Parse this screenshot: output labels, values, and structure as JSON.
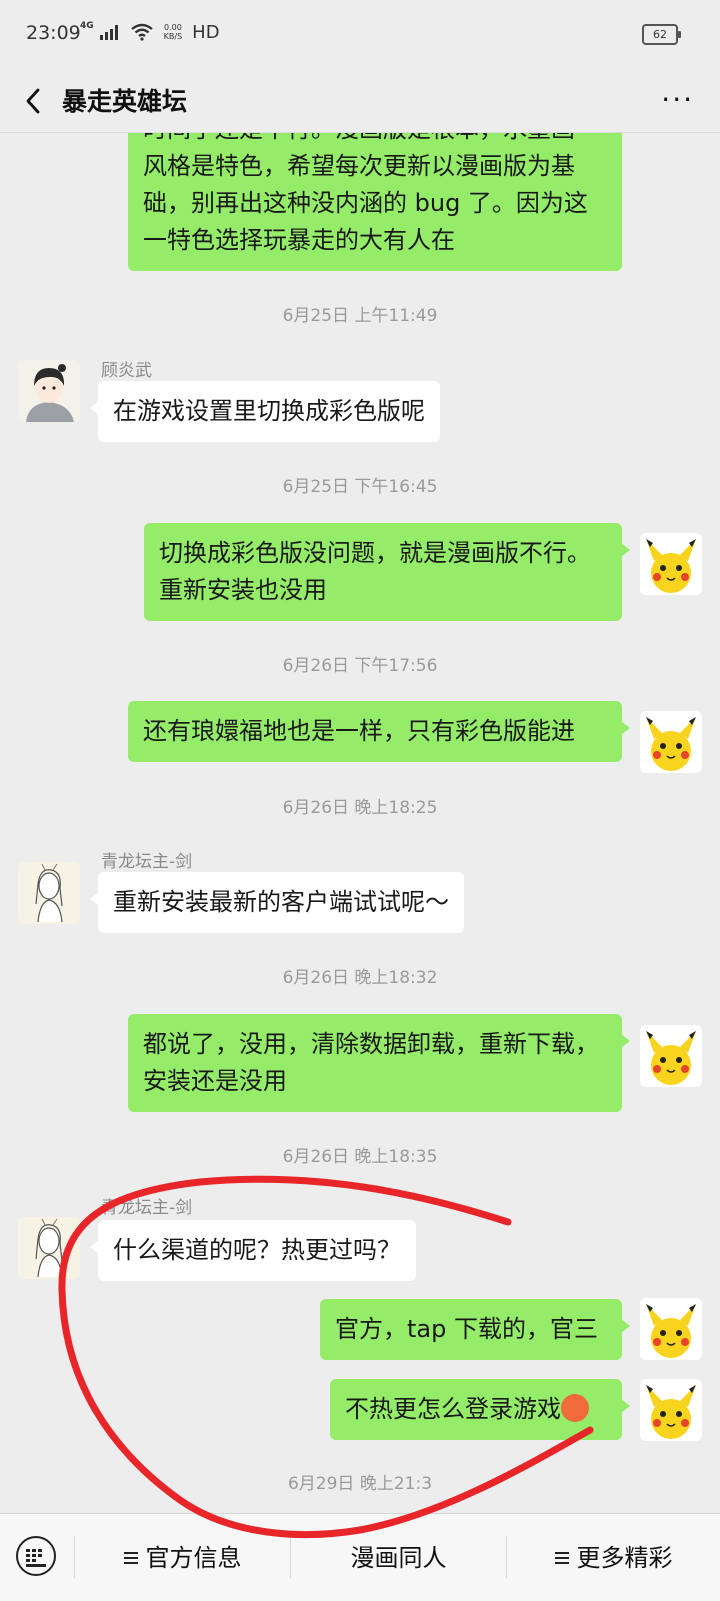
{
  "status_bar": {
    "time": "23:09",
    "network": "4G",
    "speed_value": "0.00",
    "speed_unit": "KB/S",
    "hd": "HD",
    "battery": "62"
  },
  "header": {
    "title": "暴走英雄坛"
  },
  "messages": [
    {
      "side": "me",
      "lines": [
        "时间了还是不行。漫画版是根本，水墨画",
        "风格是特色，希望每次更新以漫画版为基",
        "础，别再出这种没内涵的 bug 了。因为这",
        "一特色选择玩暴走的大有人在"
      ]
    },
    {
      "timestamp": "6月25日 上午11:49"
    },
    {
      "side": "other",
      "sender": "顾炎武",
      "lines": [
        "在游戏设置里切换成彩色版呢"
      ]
    },
    {
      "timestamp": "6月25日 下午16:45"
    },
    {
      "side": "me",
      "lines": [
        "切换成彩色版没问题，就是漫画版不行。",
        "重新安装也没用"
      ]
    },
    {
      "timestamp": "6月26日 下午17:56"
    },
    {
      "side": "me",
      "lines": [
        "还有琅嬛福地也是一样，只有彩色版能进"
      ]
    },
    {
      "timestamp": "6月26日 晚上18:25"
    },
    {
      "side": "other",
      "sender": "青龙坛主-剑",
      "lines": [
        "重新安装最新的客户端试试呢～"
      ]
    },
    {
      "timestamp": "6月26日 晚上18:32"
    },
    {
      "side": "me",
      "lines": [
        "都说了，没用，清除数据卸载，重新下载，",
        "安装还是没用"
      ]
    },
    {
      "timestamp": "6月26日 晚上18:35"
    },
    {
      "side": "other",
      "sender": "青龙坛主-剑",
      "lines": [
        "什么渠道的呢？热更过吗？"
      ]
    },
    {
      "side": "me",
      "lines": [
        "官方，tap 下载的，官三"
      ]
    },
    {
      "side": "me",
      "lines": [
        "不热更怎么登录游戏"
      ],
      "emoji": "angry-face-icon"
    },
    {
      "timestamp": "6月29日 晚上21:3"
    }
  ],
  "bottom_menu": {
    "item1": "官方信息",
    "item2": "漫画同人",
    "item3": "更多精彩"
  },
  "colors": {
    "bubble_me": "#95ec69",
    "bubble_other": "#ffffff",
    "background": "#ededed",
    "annotation": "#e8262a"
  }
}
